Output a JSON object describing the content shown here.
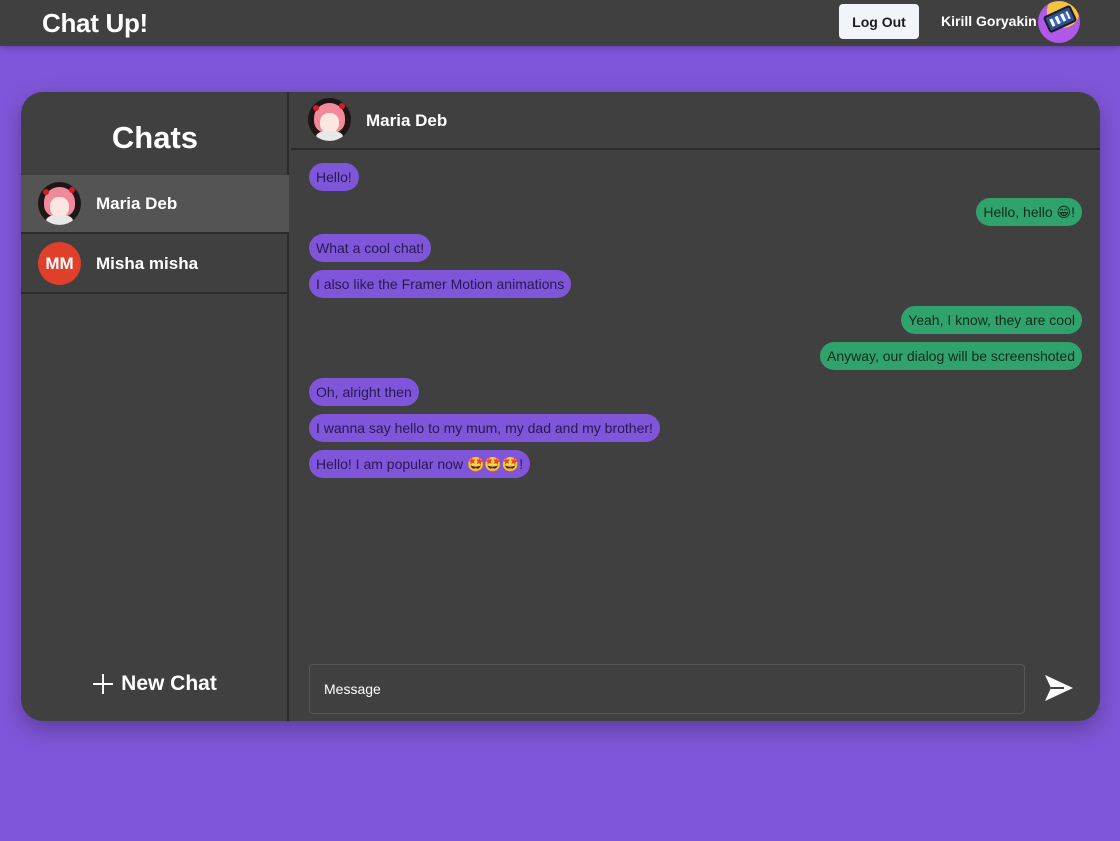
{
  "header": {
    "brand": "Chat Up!",
    "logout_label": "Log Out",
    "user_name": "Kirill Goryakin"
  },
  "sidebar": {
    "title": "Chats",
    "chats": [
      {
        "name": "Maria Deb",
        "initials": "",
        "active": true
      },
      {
        "name": "Misha misha",
        "initials": "MM",
        "active": false
      }
    ],
    "new_chat_label": "New Chat"
  },
  "conversation": {
    "contact_name": "Maria Deb",
    "messages": [
      {
        "text": "Hello!",
        "dir": "in"
      },
      {
        "text": "Hello, hello 😁!",
        "dir": "out"
      },
      {
        "text": "What a cool chat!",
        "dir": "in"
      },
      {
        "text": "I also like the Framer Motion animations",
        "dir": "in"
      },
      {
        "text": "Yeah, I know, they are cool",
        "dir": "out"
      },
      {
        "text": "Anyway, our dialog will be screenshoted",
        "dir": "out"
      },
      {
        "text": "Oh, alright then",
        "dir": "in"
      },
      {
        "text": "I wanna say hello to my mum, my dad and my brother!",
        "dir": "in"
      },
      {
        "text": "Hello! I am popular now 🤩🤩🤩!",
        "dir": "in"
      }
    ],
    "input_placeholder": "Message"
  },
  "colors": {
    "background": "#7f56d9",
    "panel": "#404040",
    "incoming_bubble": "#7f56d9",
    "outgoing_bubble": "#2fa36b",
    "avatar_initials_bg": "#e0402a"
  },
  "icons": {
    "new_chat": "plus-icon",
    "send": "send-icon"
  }
}
